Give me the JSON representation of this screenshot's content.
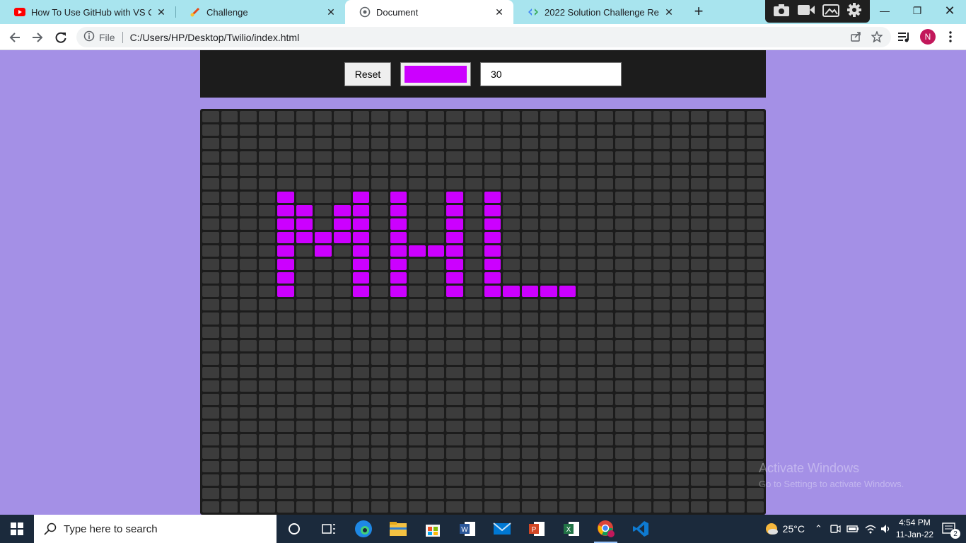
{
  "browser": {
    "tabs": [
      {
        "title": "How To Use GitHub with VS Code",
        "favicon": "youtube-icon",
        "active": false
      },
      {
        "title": "Challenge",
        "favicon": "brush-icon",
        "active": false
      },
      {
        "title": "Document",
        "favicon": "globe-icon",
        "active": true
      },
      {
        "title": "2022 Solution Challenge Resourc",
        "favicon": "devtools-icon",
        "active": false
      }
    ],
    "address": {
      "scheme": "File",
      "url": "C:/Users/HP/Desktop/Twilio/index.html"
    },
    "profile_initial": "N"
  },
  "controls": {
    "reset_label": "Reset",
    "color_value": "#cc00ff",
    "size_value": "30"
  },
  "grid": {
    "rows": 30,
    "cols": 30,
    "cell_color": "#3c3c3c",
    "paint_color": "#cc00ff",
    "painted_cells": [
      [
        6,
        4
      ],
      [
        6,
        8
      ],
      [
        6,
        10
      ],
      [
        6,
        13
      ],
      [
        6,
        15
      ],
      [
        7,
        4
      ],
      [
        7,
        5
      ],
      [
        7,
        7
      ],
      [
        7,
        8
      ],
      [
        7,
        10
      ],
      [
        7,
        13
      ],
      [
        7,
        15
      ],
      [
        8,
        4
      ],
      [
        8,
        5
      ],
      [
        8,
        7
      ],
      [
        8,
        8
      ],
      [
        8,
        10
      ],
      [
        8,
        13
      ],
      [
        8,
        15
      ],
      [
        9,
        4
      ],
      [
        9,
        5
      ],
      [
        9,
        6
      ],
      [
        9,
        7
      ],
      [
        9,
        8
      ],
      [
        9,
        10
      ],
      [
        9,
        13
      ],
      [
        9,
        15
      ],
      [
        10,
        4
      ],
      [
        10,
        6
      ],
      [
        10,
        8
      ],
      [
        10,
        10
      ],
      [
        10,
        11
      ],
      [
        10,
        12
      ],
      [
        10,
        13
      ],
      [
        10,
        15
      ],
      [
        11,
        4
      ],
      [
        11,
        8
      ],
      [
        11,
        10
      ],
      [
        11,
        13
      ],
      [
        11,
        15
      ],
      [
        12,
        4
      ],
      [
        12,
        8
      ],
      [
        12,
        10
      ],
      [
        12,
        13
      ],
      [
        12,
        15
      ],
      [
        13,
        4
      ],
      [
        13,
        8
      ],
      [
        13,
        10
      ],
      [
        13,
        13
      ],
      [
        13,
        15
      ],
      [
        13,
        16
      ],
      [
        13,
        17
      ],
      [
        13,
        18
      ],
      [
        13,
        19
      ]
    ]
  },
  "watermark": {
    "line1": "Activate Windows",
    "line2": "Go to Settings to activate Windows."
  },
  "taskbar": {
    "search_placeholder": "Type here to search",
    "weather": "25°C",
    "time": "4:54 PM",
    "date": "11-Jan-22",
    "notifications": "2"
  }
}
